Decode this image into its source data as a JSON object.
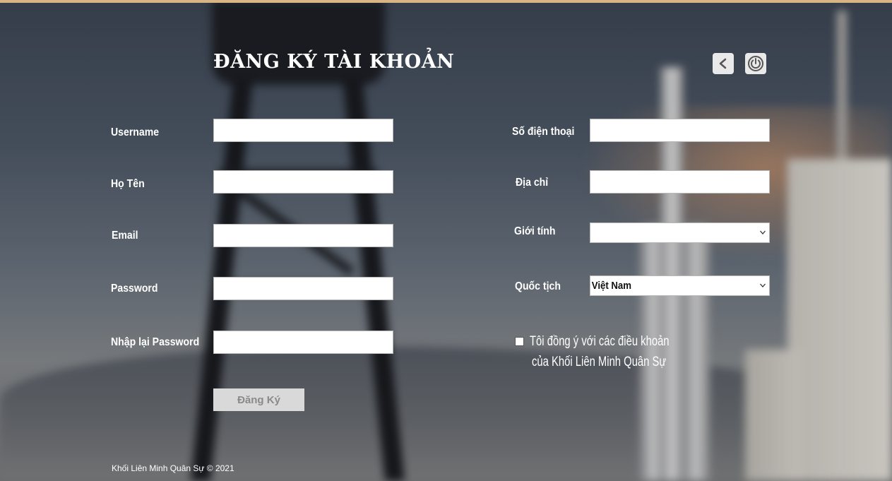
{
  "page": {
    "title": "ĐĂNG KÝ TÀI KHOẢN",
    "back_icon": "chevron-left-icon",
    "power_icon": "power-icon"
  },
  "form_left": {
    "username_label": "Username",
    "fullname_label": "Họ Tên",
    "email_label": "Email",
    "password_label": "Password",
    "confirm_password_label": "Nhập lại Password",
    "submit_label": "Đăng Ký"
  },
  "form_right": {
    "phone_label": "Số điện thoại",
    "address_label": "Địa chỉ",
    "gender_label": "Giới tính",
    "gender_value": "",
    "nationality_label": "Quốc tịch",
    "nationality_value": "Việt Nam",
    "agree_line1": "Tôi đồng ý với các điều khoản",
    "agree_line2": "của Khối Liên Minh Quân Sự",
    "agree_checked": false
  },
  "footer": {
    "text": "Khối Liên Minh Quân Sự © 2021"
  },
  "colors": {
    "top_bar": "#d9b485",
    "button_bg": "#d9d9d9",
    "button_text": "#8a8a8a"
  }
}
